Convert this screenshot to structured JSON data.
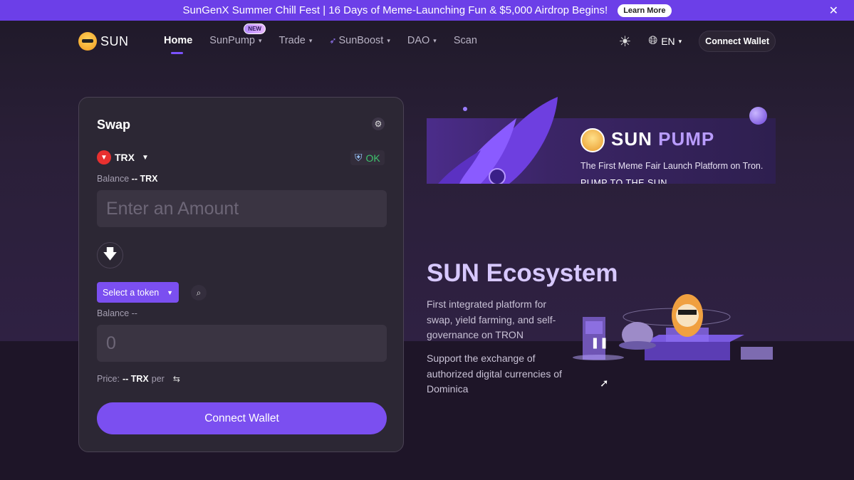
{
  "announcement": {
    "text": "SunGenX Summer Chill Fest | 16 Days of Meme-Launching Fun & $5,000 Airdrop Begins!",
    "button": "Learn More",
    "close_icon": "close-icon"
  },
  "header": {
    "logo_text": "SUN",
    "nav": {
      "home": "Home",
      "sunpump": "SunPump",
      "new_badge": "NEW",
      "trade": "Trade",
      "sunboost": "SunBoost",
      "dao": "DAO",
      "scan": "Scan"
    },
    "language": "EN",
    "connect_wallet": "Connect Wallet"
  },
  "swap": {
    "title": "Swap",
    "from_token": "TRX",
    "ok_label": "OK",
    "balance_label": "Balance",
    "balance_value": "-- TRX",
    "amount_placeholder": "Enter an Amount",
    "select_token": "Select a token",
    "balance2": "Balance --",
    "to_placeholder": "0",
    "price_label": "Price:",
    "price_value": "-- TRX",
    "price_per": "per",
    "connect_button": "Connect Wallet"
  },
  "banner": {
    "title_sun": "SUN",
    "title_pump": "PUMP",
    "subtitle": "The First Meme Fair Launch Platform on Tron.",
    "tagline": "PUMP TO THE SUN"
  },
  "ecosystem": {
    "title": "SUN Ecosystem",
    "desc1": "First integrated platform for swap, yield farming, and self-governance on TRON",
    "desc2": "Support the exchange of authorized digital currencies of Dominica"
  },
  "colors": {
    "accent": "#7b4ff0",
    "announce_bg": "#6c3fe8",
    "ok_green": "#3ec46d"
  }
}
